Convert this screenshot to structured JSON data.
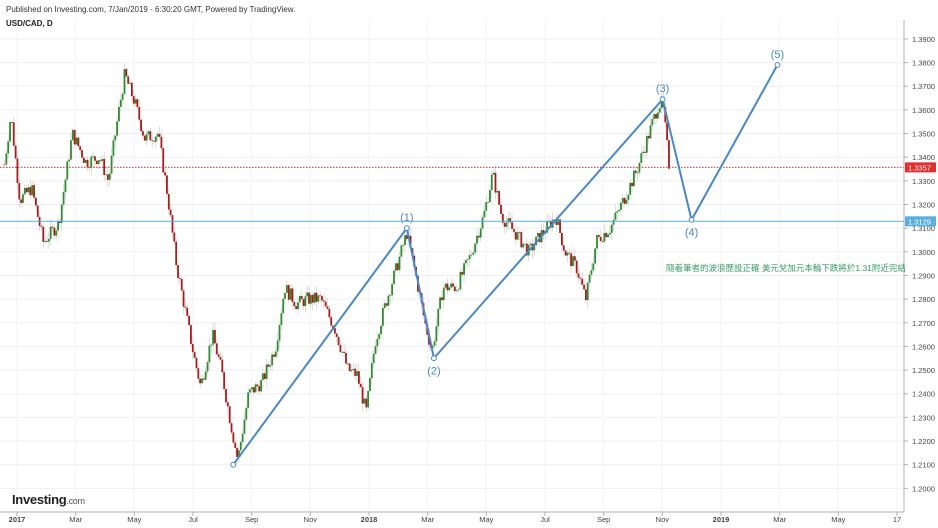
{
  "header": {
    "published": "Published on Investing.com, 7/Jan/2019 - 6:30:20 GMT, Powered by TradingView.",
    "symbol": "USD/CAD, D"
  },
  "logo": {
    "main": "Investing",
    "suffix": ".com"
  },
  "colors": {
    "up": "#2e8b2e",
    "down": "#a51c1c",
    "wave": "#4a88c4",
    "price_line": "#e03030",
    "support_line": "#5aaee0",
    "annotation": "#3a9a6a"
  },
  "chart_data": {
    "type": "candlestick",
    "ylim": [
      1.19,
      1.398
    ],
    "y_ticks": [
      1.2,
      1.21,
      1.22,
      1.23,
      1.24,
      1.25,
      1.26,
      1.27,
      1.28,
      1.29,
      1.3,
      1.31,
      1.32,
      1.33,
      1.34,
      1.35,
      1.36,
      1.37,
      1.38,
      1.39
    ],
    "x_ticks": [
      "2017",
      "Mar",
      "May",
      "Jul",
      "Sep",
      "Nov",
      "2018",
      "Mar",
      "May",
      "Jul",
      "Sep",
      "Nov",
      "2019",
      "Mar",
      "May",
      "17"
    ],
    "price_labels": [
      {
        "value": 1.3357,
        "text": "1.3357",
        "color": "#e03030",
        "style": "dotted"
      },
      {
        "value": 1.3129,
        "text": "1.3129",
        "color": "#5aaee0",
        "style": "solid"
      }
    ],
    "waves": [
      {
        "label": "",
        "t": 0.258,
        "value": 1.21
      },
      {
        "label": "(1)",
        "t": 0.45,
        "value": 1.31
      },
      {
        "label": "(2)",
        "t": 0.48,
        "value": 1.255
      },
      {
        "label": "(3)",
        "t": 0.733,
        "value": 1.3645
      },
      {
        "label": "(4)",
        "t": 0.765,
        "value": 1.3135
      },
      {
        "label": "(5)",
        "t": 0.86,
        "value": 1.379
      }
    ],
    "annotation": "隨着筆者的波浪歷設正確 美元兌加元本輪下跌將於1.31附近完結",
    "price_path": [
      {
        "t": 0.005,
        "v": 1.337
      },
      {
        "t": 0.012,
        "v": 1.358
      },
      {
        "t": 0.022,
        "v": 1.322
      },
      {
        "t": 0.035,
        "v": 1.327
      },
      {
        "t": 0.048,
        "v": 1.304
      },
      {
        "t": 0.065,
        "v": 1.312
      },
      {
        "t": 0.08,
        "v": 1.35
      },
      {
        "t": 0.095,
        "v": 1.338
      },
      {
        "t": 0.11,
        "v": 1.34
      },
      {
        "t": 0.12,
        "v": 1.33
      },
      {
        "t": 0.13,
        "v": 1.356
      },
      {
        "t": 0.138,
        "v": 1.375
      },
      {
        "t": 0.15,
        "v": 1.362
      },
      {
        "t": 0.16,
        "v": 1.348
      },
      {
        "t": 0.175,
        "v": 1.35
      },
      {
        "t": 0.185,
        "v": 1.325
      },
      {
        "t": 0.195,
        "v": 1.295
      },
      {
        "t": 0.205,
        "v": 1.275
      },
      {
        "t": 0.215,
        "v": 1.255
      },
      {
        "t": 0.222,
        "v": 1.243
      },
      {
        "t": 0.235,
        "v": 1.265
      },
      {
        "t": 0.245,
        "v": 1.25
      },
      {
        "t": 0.255,
        "v": 1.228
      },
      {
        "t": 0.263,
        "v": 1.212
      },
      {
        "t": 0.275,
        "v": 1.24
      },
      {
        "t": 0.29,
        "v": 1.245
      },
      {
        "t": 0.305,
        "v": 1.26
      },
      {
        "t": 0.315,
        "v": 1.285
      },
      {
        "t": 0.328,
        "v": 1.278
      },
      {
        "t": 0.34,
        "v": 1.28
      },
      {
        "t": 0.355,
        "v": 1.28
      },
      {
        "t": 0.37,
        "v": 1.268
      },
      {
        "t": 0.385,
        "v": 1.25
      },
      {
        "t": 0.395,
        "v": 1.248
      },
      {
        "t": 0.405,
        "v": 1.232
      },
      {
        "t": 0.415,
        "v": 1.262
      },
      {
        "t": 0.428,
        "v": 1.28
      },
      {
        "t": 0.44,
        "v": 1.295
      },
      {
        "t": 0.45,
        "v": 1.308
      },
      {
        "t": 0.46,
        "v": 1.29
      },
      {
        "t": 0.47,
        "v": 1.27
      },
      {
        "t": 0.478,
        "v": 1.258
      },
      {
        "t": 0.49,
        "v": 1.285
      },
      {
        "t": 0.505,
        "v": 1.285
      },
      {
        "t": 0.52,
        "v": 1.298
      },
      {
        "t": 0.535,
        "v": 1.315
      },
      {
        "t": 0.545,
        "v": 1.333
      },
      {
        "t": 0.555,
        "v": 1.315
      },
      {
        "t": 0.57,
        "v": 1.308
      },
      {
        "t": 0.585,
        "v": 1.3
      },
      {
        "t": 0.6,
        "v": 1.308
      },
      {
        "t": 0.615,
        "v": 1.315
      },
      {
        "t": 0.625,
        "v": 1.3
      },
      {
        "t": 0.638,
        "v": 1.293
      },
      {
        "t": 0.648,
        "v": 1.28
      },
      {
        "t": 0.66,
        "v": 1.305
      },
      {
        "t": 0.675,
        "v": 1.31
      },
      {
        "t": 0.69,
        "v": 1.322
      },
      {
        "t": 0.705,
        "v": 1.335
      },
      {
        "t": 0.718,
        "v": 1.35
      },
      {
        "t": 0.728,
        "v": 1.362
      },
      {
        "t": 0.733,
        "v": 1.363
      },
      {
        "t": 0.74,
        "v": 1.337
      }
    ]
  }
}
